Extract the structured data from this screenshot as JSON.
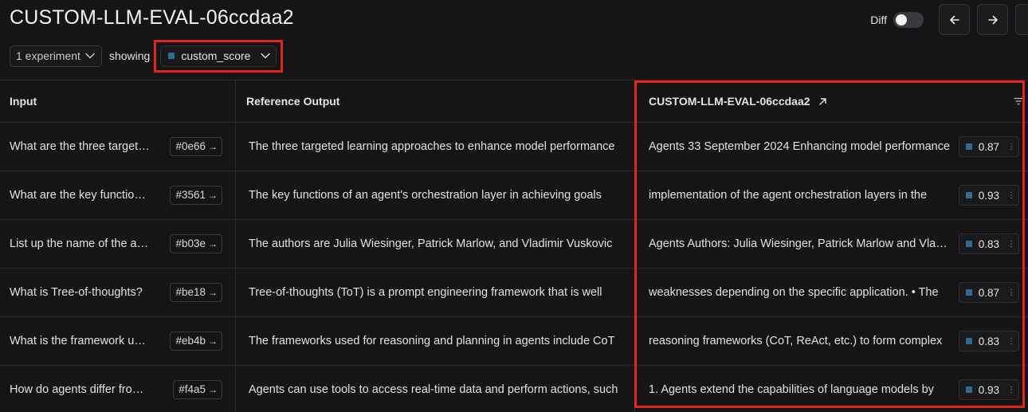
{
  "page": {
    "title": "CUSTOM-LLM-EVAL-06ccdaa2"
  },
  "toolbar": {
    "diff_label": "Diff",
    "diff_enabled": false,
    "prev_icon": "arrow-left-icon",
    "next_icon": "arrow-right-icon"
  },
  "controls": {
    "experiments_label": "1 experiment",
    "showing_label": "showing",
    "metric_label": "custom_score",
    "metric_color": "#2f6b94",
    "highlight_color": "#e2261c"
  },
  "table": {
    "headers": {
      "input": "Input",
      "reference": "Reference Output",
      "experiment": "CUSTOM-LLM-EVAL-06ccdaa2"
    },
    "rows": [
      {
        "input": "What are the three targeted learning approaches",
        "id": "#0e66",
        "reference": "The three targeted learning approaches to enhance model performance",
        "output": "Agents 33 September 2024 Enhancing model performance",
        "score": "0.87"
      },
      {
        "input": "What are the key functions of an agent's orchestration layer",
        "id": "#3561",
        "reference": "The key functions of an agent's orchestration layer in achieving goals",
        "output": "implementation of the agent orchestration layers in the",
        "score": "0.93"
      },
      {
        "input": "List up the name of the authors",
        "id": "#b03e",
        "reference": "The authors are Julia Wiesinger, Patrick Marlow, and Vladimir Vuskovic",
        "output": "Agents Authors: Julia Wiesinger, Patrick Marlow and Vladimir",
        "score": "0.83"
      },
      {
        "input": "What is Tree-of-thoughts?",
        "id": "#be18",
        "reference": "Tree-of-thoughts (ToT) is a prompt engineering framework that is well",
        "output": "weaknesses depending on the specific application. • The",
        "score": "0.87"
      },
      {
        "input": "What is the framework used for reasoning",
        "id": "#eb4b",
        "reference": "The frameworks used for reasoning and planning in agents include CoT",
        "output": "reasoning frameworks (CoT, ReAct, etc.) to form complex",
        "score": "0.83"
      },
      {
        "input": "How do agents differ from standalone models",
        "id": "#f4a5",
        "reference": "Agents can use tools to access real-time data and perform actions, such",
        "output": "1. Agents extend the capabilities of language models by",
        "score": "0.93"
      }
    ]
  }
}
